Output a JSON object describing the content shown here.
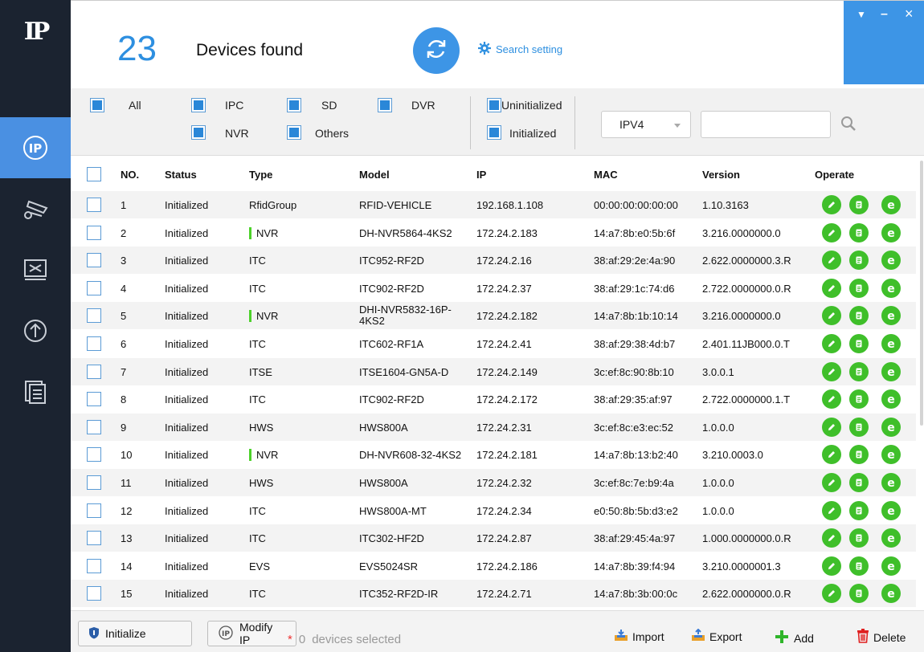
{
  "app": {
    "logo_text": "IP"
  },
  "sidebar": {
    "items": [
      {
        "name": "ip-icon",
        "active": true
      },
      {
        "name": "camera-settings-icon",
        "active": false
      },
      {
        "name": "tools-icon",
        "active": false
      },
      {
        "name": "upgrade-icon",
        "active": false
      },
      {
        "name": "documents-icon",
        "active": false
      }
    ]
  },
  "header": {
    "count": "23",
    "found_label": "Devices found",
    "search_setting_label": "Search setting"
  },
  "window_controls": {
    "menu": "▼",
    "minimize": "–",
    "close": "×"
  },
  "filters": {
    "all": "All",
    "ipc": "IPC",
    "sd": "SD",
    "dvr": "DVR",
    "nvr": "NVR",
    "others": "Others",
    "uninitialized": "Uninitialized",
    "initialized": "Initialized",
    "ip_version": "IPV4",
    "search_value": ""
  },
  "table": {
    "headers": {
      "no": "NO.",
      "status": "Status",
      "type": "Type",
      "model": "Model",
      "ip": "IP",
      "mac": "MAC",
      "version": "Version",
      "operate": "Operate"
    },
    "rows": [
      {
        "no": "1",
        "status": "Initialized",
        "type": "RfidGroup",
        "model": "RFID-VEHICLE",
        "ip": "192.168.1.108",
        "mac": "00:00:00:00:00:00",
        "version": "1.10.3163"
      },
      {
        "no": "2",
        "status": "Initialized",
        "type": "NVR",
        "model": "DH-NVR5864-4KS2",
        "ip": "172.24.2.183",
        "mac": "14:a7:8b:e0:5b:6f",
        "version": "3.216.0000000.0"
      },
      {
        "no": "3",
        "status": "Initialized",
        "type": "ITC",
        "model": "ITC952-RF2D",
        "ip": "172.24.2.16",
        "mac": "38:af:29:2e:4a:90",
        "version": "2.622.0000000.3.R"
      },
      {
        "no": "4",
        "status": "Initialized",
        "type": "ITC",
        "model": "ITC902-RF2D",
        "ip": "172.24.2.37",
        "mac": "38:af:29:1c:74:d6",
        "version": "2.722.0000000.0.R"
      },
      {
        "no": "5",
        "status": "Initialized",
        "type": "NVR",
        "model": "DHI-NVR5832-16P-4KS2",
        "ip": "172.24.2.182",
        "mac": "14:a7:8b:1b:10:14",
        "version": "3.216.0000000.0"
      },
      {
        "no": "6",
        "status": "Initialized",
        "type": "ITC",
        "model": "ITC602-RF1A",
        "ip": "172.24.2.41",
        "mac": "38:af:29:38:4d:b7",
        "version": "2.401.11JB000.0.T"
      },
      {
        "no": "7",
        "status": "Initialized",
        "type": "ITSE",
        "model": "ITSE1604-GN5A-D",
        "ip": "172.24.2.149",
        "mac": "3c:ef:8c:90:8b:10",
        "version": "3.0.0.1"
      },
      {
        "no": "8",
        "status": "Initialized",
        "type": "ITC",
        "model": "ITC902-RF2D",
        "ip": "172.24.2.172",
        "mac": "38:af:29:35:af:97",
        "version": "2.722.0000000.1.T"
      },
      {
        "no": "9",
        "status": "Initialized",
        "type": "HWS",
        "model": "HWS800A",
        "ip": "172.24.2.31",
        "mac": "3c:ef:8c:e3:ec:52",
        "version": "1.0.0.0"
      },
      {
        "no": "10",
        "status": "Initialized",
        "type": "NVR",
        "model": "DH-NVR608-32-4KS2",
        "ip": "172.24.2.181",
        "mac": "14:a7:8b:13:b2:40",
        "version": "3.210.0003.0"
      },
      {
        "no": "11",
        "status": "Initialized",
        "type": "HWS",
        "model": "HWS800A",
        "ip": "172.24.2.32",
        "mac": "3c:ef:8c:7e:b9:4a",
        "version": "1.0.0.0"
      },
      {
        "no": "12",
        "status": "Initialized",
        "type": "ITC",
        "model": "HWS800A-MT",
        "ip": "172.24.2.34",
        "mac": "e0:50:8b:5b:d3:e2",
        "version": "1.0.0.0"
      },
      {
        "no": "13",
        "status": "Initialized",
        "type": "ITC",
        "model": "ITC302-HF2D",
        "ip": "172.24.2.87",
        "mac": "38:af:29:45:4a:97",
        "version": "1.000.0000000.0.R"
      },
      {
        "no": "14",
        "status": "Initialized",
        "type": "EVS",
        "model": "EVS5024SR",
        "ip": "172.24.2.186",
        "mac": "14:a7:8b:39:f4:94",
        "version": "3.210.0000001.3"
      },
      {
        "no": "15",
        "status": "Initialized",
        "type": "ITC",
        "model": "ITC352-RF2D-IR",
        "ip": "172.24.2.71",
        "mac": "14:a7:8b:3b:00:0c",
        "version": "2.622.0000000.0.R"
      }
    ]
  },
  "footer": {
    "initialize_label": "Initialize",
    "modify_ip_label": "Modify IP",
    "selected_star": "*",
    "selected_count": "0",
    "selected_text": "devices selected",
    "import_label": "Import",
    "export_label": "Export",
    "add_label": "Add",
    "delete_label": "Delete"
  },
  "colors": {
    "sidebar_bg": "#1b2330",
    "accent_blue": "#3d95e6",
    "checkbox_blue": "#2a87d8",
    "operate_green": "#3fbf2a",
    "nvr_marker": "#4cd12a",
    "delete_red": "#e02020"
  }
}
